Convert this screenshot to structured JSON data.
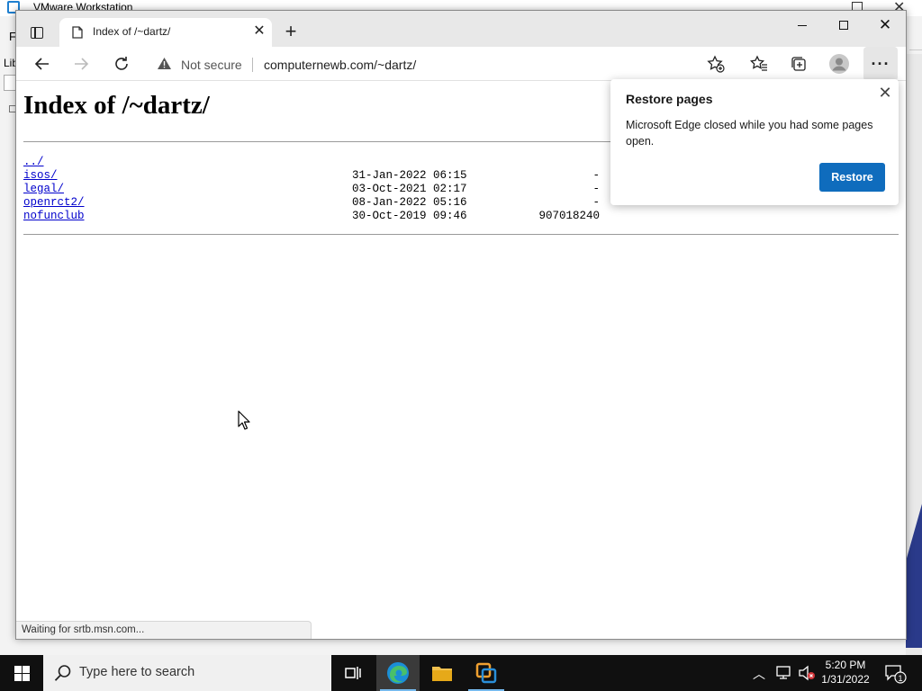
{
  "background_window": {
    "title": "VMware Workstation",
    "menu_fragment": "F",
    "library_fragment": "Lib"
  },
  "browser": {
    "tab": {
      "title": "Index of /~dartz/"
    },
    "address_bar": {
      "security_label": "Not secure",
      "url": "computernewb.com/~dartz/"
    },
    "status_text": "Waiting for srtb.msn.com..."
  },
  "page": {
    "heading": "Index of /~dartz/",
    "entries": [
      {
        "name": "../",
        "date": "",
        "size": ""
      },
      {
        "name": "isos/",
        "date": "31-Jan-2022 06:15",
        "size": "-"
      },
      {
        "name": "legal/",
        "date": "03-Oct-2021 02:17",
        "size": "-"
      },
      {
        "name": "openrct2/",
        "date": "08-Jan-2022 05:16",
        "size": "-"
      },
      {
        "name": "nofunclub",
        "date": "30-Oct-2019 09:46",
        "size": "907018240"
      }
    ]
  },
  "restore_popup": {
    "title": "Restore pages",
    "message": "Microsoft Edge closed while you had some pages open.",
    "button_label": "Restore"
  },
  "taskbar": {
    "search_placeholder": "Type here to search",
    "time": "5:20 PM",
    "date": "1/31/2022",
    "notification_count": "1"
  },
  "icons": {
    "start": "windows-logo-icon",
    "task_view": "task-view-icon",
    "edge": "edge-icon",
    "explorer": "folder-icon",
    "vmware": "vmware-icon"
  },
  "colors": {
    "accent_button": "#0f6cbd",
    "link": "#0000cc",
    "taskbar": "#101010"
  }
}
